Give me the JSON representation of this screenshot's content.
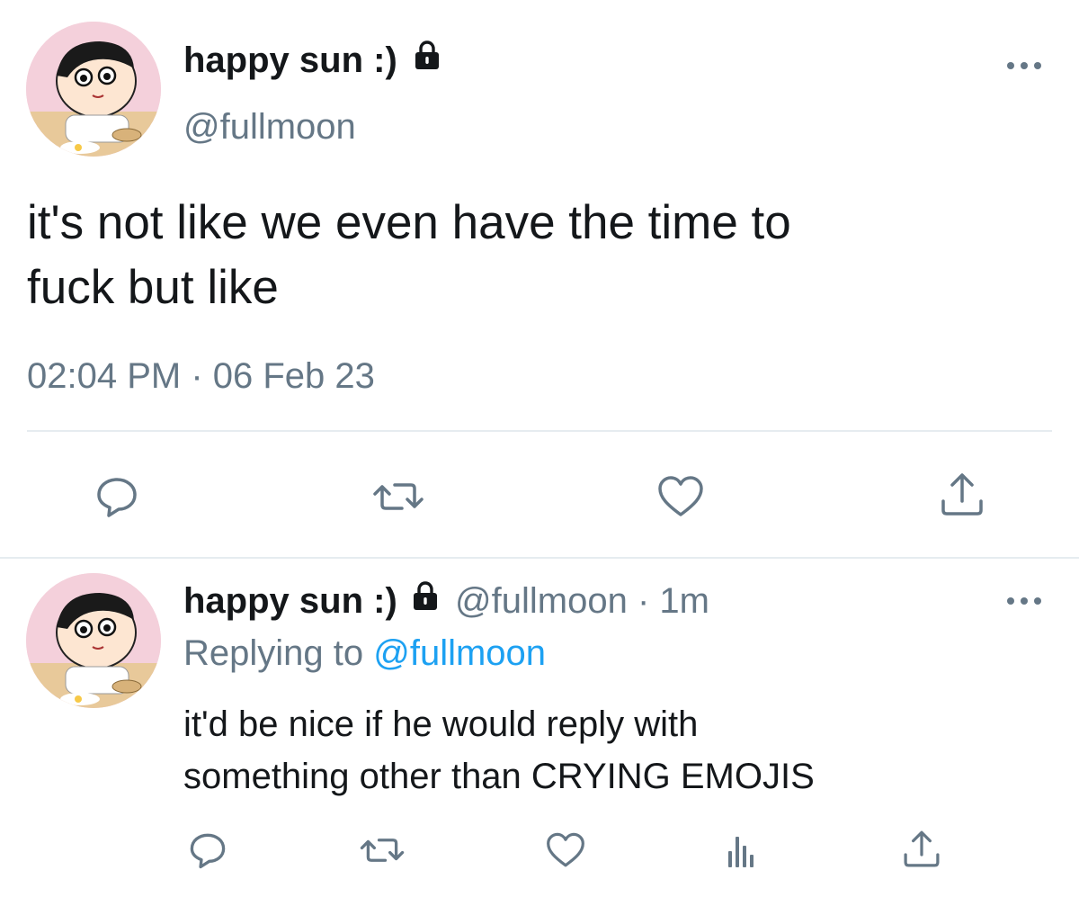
{
  "tweet": {
    "display_name": "happy sun :)",
    "handle": "@fullmoon",
    "text_line1": "it's not like we even have the time to",
    "text_line2": "fuck but like",
    "time": "02:04 PM",
    "separator": " · ",
    "date": "06 Feb 23"
  },
  "reply": {
    "display_name": "happy sun :)",
    "handle": "@fullmoon",
    "separator": " · ",
    "age": "1m",
    "replying_prefix": "Replying to",
    "replying_handle": "@fullmoon",
    "text_line1": "it'd be nice if he would reply with",
    "text_line2": "something other than CRYING EMOJIS"
  },
  "icons": {
    "reply": "reply-icon",
    "retweet": "retweet-icon",
    "like": "heart-icon",
    "share": "share-icon",
    "analytics": "analytics-icon",
    "more": "more-icon",
    "lock": "lock-icon"
  },
  "colors": {
    "text": "#14171a",
    "muted": "#657786",
    "link": "#1da1f2",
    "divider": "#e6ecf0"
  }
}
